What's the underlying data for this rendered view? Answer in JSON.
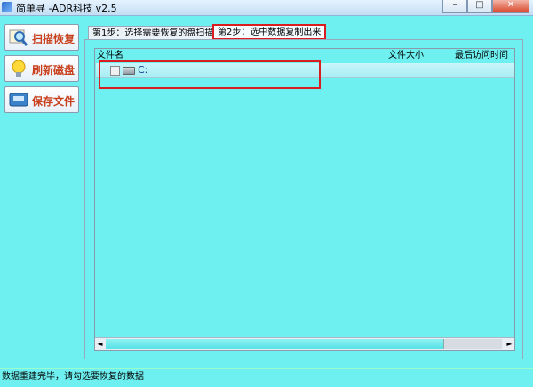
{
  "window": {
    "title": "简单寻  -ADR科技 v2.5",
    "controls": [
      "–",
      "□",
      "✕"
    ]
  },
  "sidebar": {
    "buttons": [
      {
        "label": "扫描恢复",
        "icon": "magnifier-icon"
      },
      {
        "label": "刷新磁盘",
        "icon": "lightbulb-icon"
      },
      {
        "label": "保存文件",
        "icon": "save-icon"
      }
    ]
  },
  "tabs": [
    {
      "label": "第1步：选择需要恢复的盘扫描",
      "active": false
    },
    {
      "label": "第2步：选中数据复制出来",
      "active": true
    }
  ],
  "list": {
    "columns": [
      "文件名",
      "文件大小",
      "最后访问时间"
    ],
    "rows": [
      {
        "name": "C:",
        "checked": false
      }
    ],
    "scrollbar": {
      "left": "◄",
      "right": "►"
    }
  },
  "status": {
    "text": "数据重建完毕，请勾选要恢复的数据"
  },
  "colors": {
    "background": "#6ff0f0",
    "highlight_box": "#d81e1e",
    "button_label": "#c8401e"
  }
}
